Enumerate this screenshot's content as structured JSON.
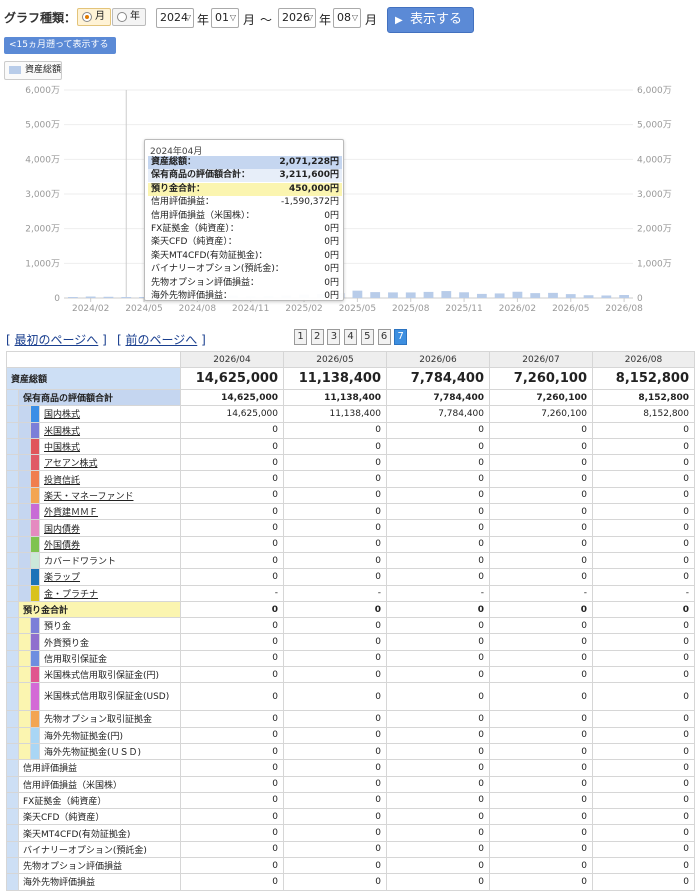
{
  "controls": {
    "graph_type_label": "グラフ種類：",
    "radio_month": "月",
    "radio_year": "年",
    "from_year": "2024",
    "year_unit": "年",
    "from_month": "01",
    "month_unit": "月",
    "tilde": "〜",
    "to_year": "2026",
    "to_month": "08",
    "show_button": "表示する",
    "back_15_months": "<15ヵ月遡って表示する",
    "legend_label": "資産総額"
  },
  "colors": {
    "bar": "#b8cce9",
    "total_label_bg": "#cddff5",
    "holdings_bar": "#c5d6f0",
    "deposit_bar": "#fbf5b0",
    "button": "#5b8ad6",
    "current_page": "#3d8fe0"
  },
  "chart_data": {
    "type": "bar",
    "series": [
      {
        "name": "資産総額",
        "values": [
          280000,
          420000,
          350000,
          280000,
          290000,
          2071228,
          350000,
          260000,
          320000,
          650000,
          470000,
          520000,
          720000,
          950000,
          1120000,
          1400000,
          2120000,
          1700000,
          1620000,
          1610000,
          1760000,
          2000000,
          1650000,
          1180000,
          1320000,
          1800000,
          1410000,
          1480000,
          1120000,
          800000,
          730000,
          860000
        ]
      }
    ],
    "categories": [
      "2024/01",
      "2024/02",
      "2024/03",
      "2024/04",
      "2024/05",
      "2024/06",
      "2024/07",
      "2024/08",
      "2024/09",
      "2024/10",
      "2024/11",
      "2024/12",
      "2025/01",
      "2025/02",
      "2025/03",
      "2025/04",
      "2025/05",
      "2025/06",
      "2025/07",
      "2025/08",
      "2025/09",
      "2025/10",
      "2025/11",
      "2025/12",
      "2026/01",
      "2026/02",
      "2026/03",
      "2026/04",
      "2026/05",
      "2026/06",
      "2026/07",
      "2026/08"
    ],
    "x_tick_labels": [
      "2024/02",
      "2024/05",
      "2024/08",
      "2024/11",
      "2025/02",
      "2025/05",
      "2025/08",
      "2025/11",
      "2026/02",
      "2026/05",
      "2026/08"
    ],
    "y_tick_labels": [
      "0",
      "1,000万",
      "2,000万",
      "3,000万",
      "4,000万",
      "5,000万",
      "6,000万"
    ],
    "y_tick_labels_right": [
      "0",
      "1,000万",
      "2,000万",
      "3,000万",
      "4,000万",
      "5,000万",
      "6,000万"
    ],
    "ylim": [
      0,
      60000000
    ]
  },
  "tooltip": {
    "title": "2024年04月",
    "rows": [
      {
        "label": "資産総額：",
        "value": "2,071,228円",
        "style": "total"
      },
      {
        "label": "保有商品の評価額合計：",
        "value": "3,211,600円",
        "style": "holdings"
      },
      {
        "label": "預り金合計：",
        "value": "450,000円",
        "style": "deposit"
      },
      {
        "label": "信用評価損益：",
        "value": "-1,590,372円",
        "style": "plain"
      },
      {
        "label": "信用評価損益（米国株）：",
        "value": "0円",
        "style": "plain"
      },
      {
        "label": "FX証拠金（純資産）：",
        "value": "0円",
        "style": "plain"
      },
      {
        "label": "楽天CFD（純資産）：",
        "value": "0円",
        "style": "plain"
      },
      {
        "label": "楽天MT4CFD(有効証拠金)：",
        "value": "0円",
        "style": "plain"
      },
      {
        "label": "バイナリーオプション(預託金)：",
        "value": "0円",
        "style": "plain"
      },
      {
        "label": "先物オプション評価損益：",
        "value": "0円",
        "style": "plain"
      },
      {
        "label": "海外先物評価損益：",
        "value": "0円",
        "style": "plain"
      }
    ]
  },
  "pager": {
    "first": "最初のページへ",
    "prev": "前のページへ",
    "pages": [
      "1",
      "2",
      "3",
      "4",
      "5",
      "6",
      "7"
    ],
    "current": "7"
  },
  "table": {
    "months": [
      "2026/04",
      "2026/05",
      "2026/06",
      "2026/07",
      "2026/08"
    ],
    "total": {
      "label": "資産総額",
      "values": [
        "14,625,000",
        "11,138,400",
        "7,784,400",
        "7,260,100",
        "8,152,800"
      ]
    },
    "holdings": {
      "label": "保有商品の評価額合計",
      "values": [
        "14,625,000",
        "11,138,400",
        "7,784,400",
        "7,260,100",
        "8,152,800"
      ],
      "items": [
        {
          "label": "国内株式",
          "color": "#3a8ee6",
          "link": true,
          "values": [
            "14,625,000",
            "11,138,400",
            "7,784,400",
            "7,260,100",
            "8,152,800"
          ]
        },
        {
          "label": "米国株式",
          "color": "#7b7ed8",
          "link": true,
          "values": [
            "0",
            "0",
            "0",
            "0",
            "0"
          ]
        },
        {
          "label": "中国株式",
          "color": "#e0565a",
          "link": true,
          "values": [
            "0",
            "0",
            "0",
            "0",
            "0"
          ]
        },
        {
          "label": "アセアン株式",
          "color": "#e05a66",
          "link": true,
          "values": [
            "0",
            "0",
            "0",
            "0",
            "0"
          ]
        },
        {
          "label": "投資信託",
          "color": "#f07e4e",
          "link": true,
          "values": [
            "0",
            "0",
            "0",
            "0",
            "0"
          ]
        },
        {
          "label": "楽天・マネーファンド",
          "color": "#f3a552",
          "link": true,
          "values": [
            "0",
            "0",
            "0",
            "0",
            "0"
          ]
        },
        {
          "label": "外貨建ＭＭＦ",
          "color": "#c86bd6",
          "link": true,
          "values": [
            "0",
            "0",
            "0",
            "0",
            "0"
          ]
        },
        {
          "label": "国内債券",
          "color": "#e58ac0",
          "link": true,
          "values": [
            "0",
            "0",
            "0",
            "0",
            "0"
          ]
        },
        {
          "label": "外国債券",
          "color": "#7fc34f",
          "link": true,
          "values": [
            "0",
            "0",
            "0",
            "0",
            "0"
          ]
        },
        {
          "label": "カバードワラント",
          "color": "#cce8d9",
          "link": false,
          "values": [
            "0",
            "0",
            "0",
            "0",
            "0"
          ]
        },
        {
          "label": "楽ラップ",
          "color": "#1b73b8",
          "link": true,
          "values": [
            "0",
            "0",
            "0",
            "0",
            "0"
          ]
        },
        {
          "label": "金・プラチナ",
          "color": "#d9c21b",
          "link": true,
          "values": [
            "-",
            "-",
            "-",
            "-",
            "-"
          ]
        }
      ]
    },
    "deposits": {
      "label": "預り金合計",
      "values": [
        "0",
        "0",
        "0",
        "0",
        "0"
      ],
      "items": [
        {
          "label": "預り金",
          "color": "#7b7ed8",
          "values": [
            "0",
            "0",
            "0",
            "0",
            "0"
          ]
        },
        {
          "label": "外貨預り金",
          "color": "#8f6fce",
          "values": [
            "0",
            "0",
            "0",
            "0",
            "0"
          ]
        },
        {
          "label": "信用取引保証金",
          "color": "#6e8ee0",
          "values": [
            "0",
            "0",
            "0",
            "0",
            "0"
          ]
        },
        {
          "label": "米国株式信用取引保証金(円)",
          "color": "#e0568e",
          "values": [
            "0",
            "0",
            "0",
            "0",
            "0"
          ]
        },
        {
          "label": "米国株式信用取引保証金(USD)",
          "color": "#d36ad6",
          "values": [
            "0",
            "0",
            "0",
            "0",
            "0"
          ],
          "tall": true
        },
        {
          "label": "先物オプション取引証拠金",
          "color": "#f3a552",
          "values": [
            "0",
            "0",
            "0",
            "0",
            "0"
          ]
        },
        {
          "label": "海外先物証拠金(円)",
          "color": "#a9d6f5",
          "values": [
            "0",
            "0",
            "0",
            "0",
            "0"
          ]
        },
        {
          "label": "海外先物証拠金(ＵＳＤ)",
          "color": "#a9d6f5",
          "values": [
            "0",
            "0",
            "0",
            "0",
            "0"
          ]
        }
      ]
    },
    "others": [
      {
        "label": "信用評価損益",
        "values": [
          "0",
          "0",
          "0",
          "0",
          "0"
        ]
      },
      {
        "label": "信用評価損益（米国株）",
        "values": [
          "0",
          "0",
          "0",
          "0",
          "0"
        ]
      },
      {
        "label": "FX証拠金（純資産）",
        "values": [
          "0",
          "0",
          "0",
          "0",
          "0"
        ]
      },
      {
        "label": "楽天CFD（純資産）",
        "values": [
          "0",
          "0",
          "0",
          "0",
          "0"
        ]
      },
      {
        "label": "楽天MT4CFD(有効証拠金)",
        "values": [
          "0",
          "0",
          "0",
          "0",
          "0"
        ]
      },
      {
        "label": "バイナリーオプション(預託金)",
        "values": [
          "0",
          "0",
          "0",
          "0",
          "0"
        ]
      },
      {
        "label": "先物オプション評価損益",
        "values": [
          "0",
          "0",
          "0",
          "0",
          "0"
        ]
      },
      {
        "label": "海外先物評価損益",
        "values": [
          "0",
          "0",
          "0",
          "0",
          "0"
        ]
      }
    ]
  }
}
